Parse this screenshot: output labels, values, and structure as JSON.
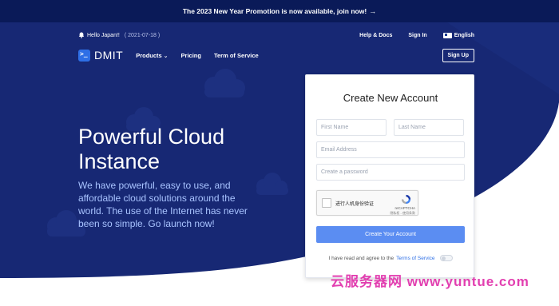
{
  "promo": {
    "text": "The 2023 New Year Promotion is now available, join now!",
    "arrow": "→"
  },
  "topbar": {
    "hello": "Hello Japan!!",
    "date": "( 2021-07-18 )",
    "help": "Help & Docs",
    "signin": "Sign In",
    "language": "English"
  },
  "nav": {
    "brand": "DMIT",
    "items": [
      "Products",
      "Pricing",
      "Term of Service"
    ],
    "signup": "Sign Up"
  },
  "hero": {
    "headline_line1": "Powerful Cloud",
    "headline_line2": "Instance",
    "subtext": "We have powerful, easy to use, and affordable cloud solutions around the world. The use of the Internet has never been so simple. Go launch now!"
  },
  "form": {
    "title": "Create New Account",
    "first_name_placeholder": "First Name",
    "last_name_placeholder": "Last Name",
    "email_placeholder": "Email Address",
    "password_placeholder": "Create a password",
    "captcha_label": "进行人机身份验证",
    "captcha_brand": "reCAPTCHA",
    "captcha_terms": "隐私权 - 使用条款",
    "submit": "Create Your Account",
    "agree_text": "I have read and agree to the",
    "agree_link": "Terms of Service"
  },
  "watermark": "云服务器网 www.yuntue.com",
  "colors": {
    "navy": "#0a1a58",
    "hero": "#162672",
    "accent": "#2e6fe6",
    "button": "#5b8df2",
    "watermark": "#e23fb0"
  }
}
